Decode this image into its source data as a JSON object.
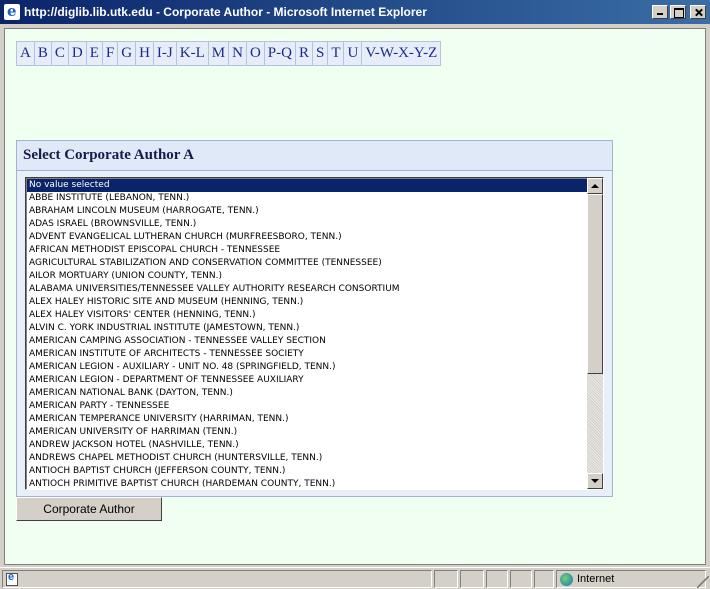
{
  "window": {
    "title": "http://diglib.lib.utk.edu - Corporate Author - Microsoft Internet Explorer"
  },
  "alpha_nav": [
    "A",
    "B",
    "C",
    "D",
    "E",
    "F",
    "G",
    "H",
    "I-J",
    "K-L",
    "M",
    "N",
    "O",
    "P-Q",
    "R",
    "S",
    "T",
    "U",
    "V-W-X-Y-Z"
  ],
  "panel": {
    "title": "Select Corporate Author A"
  },
  "list": {
    "selected_index": 0,
    "items": [
      "No value selected",
      "ABBE INSTITUTE (LEBANON, TENN.)",
      "ABRAHAM LINCOLN MUSEUM (HARROGATE, TENN.)",
      "ADAS ISRAEL (BROWNSVILLE, TENN.)",
      "ADVENT EVANGELICAL LUTHERAN CHURCH (MURFREESBORO, TENN.)",
      "AFRICAN METHODIST EPISCOPAL CHURCH - TENNESSEE",
      "AGRICULTURAL STABILIZATION AND CONSERVATION COMMITTEE (TENNESSEE)",
      "AILOR MORTUARY (UNION COUNTY, TENN.)",
      "ALABAMA UNIVERSITIES/TENNESSEE VALLEY AUTHORITY RESEARCH CONSORTIUM",
      "ALEX HALEY HISTORIC SITE AND MUSEUM (HENNING, TENN.)",
      "ALEX HALEY VISITORS' CENTER (HENNING, TENN.)",
      "ALVIN C. YORK INDUSTRIAL INSTITUTE (JAMESTOWN, TENN.)",
      "AMERICAN CAMPING ASSOCIATION - TENNESSEE VALLEY SECTION",
      "AMERICAN INSTITUTE OF ARCHITECTS - TENNESSEE SOCIETY",
      "AMERICAN LEGION - AUXILIARY - UNIT NO. 48 (SPRINGFIELD, TENN.)",
      "AMERICAN LEGION - DEPARTMENT OF TENNESSEE AUXILIARY",
      "AMERICAN NATIONAL BANK (DAYTON, TENN.)",
      "AMERICAN PARTY - TENNESSEE",
      "AMERICAN TEMPERANCE UNIVERSITY (HARRIMAN, TENN.)",
      "AMERICAN UNIVERSITY OF HARRIMAN (TENN.)",
      "ANDREW JACKSON HOTEL (NASHVILLE, TENN.)",
      "ANDREWS CHAPEL METHODIST CHURCH (HUNTERSVILLE, TENN.)",
      "ANTIOCH BAPTIST CHURCH (JEFFERSON COUNTY, TENN.)",
      "ANTIOCH PRIMITIVE BAPTIST CHURCH (HARDEMAN COUNTY, TENN.)"
    ]
  },
  "submit_label": "Corporate Author",
  "status": {
    "zone": "Internet"
  }
}
